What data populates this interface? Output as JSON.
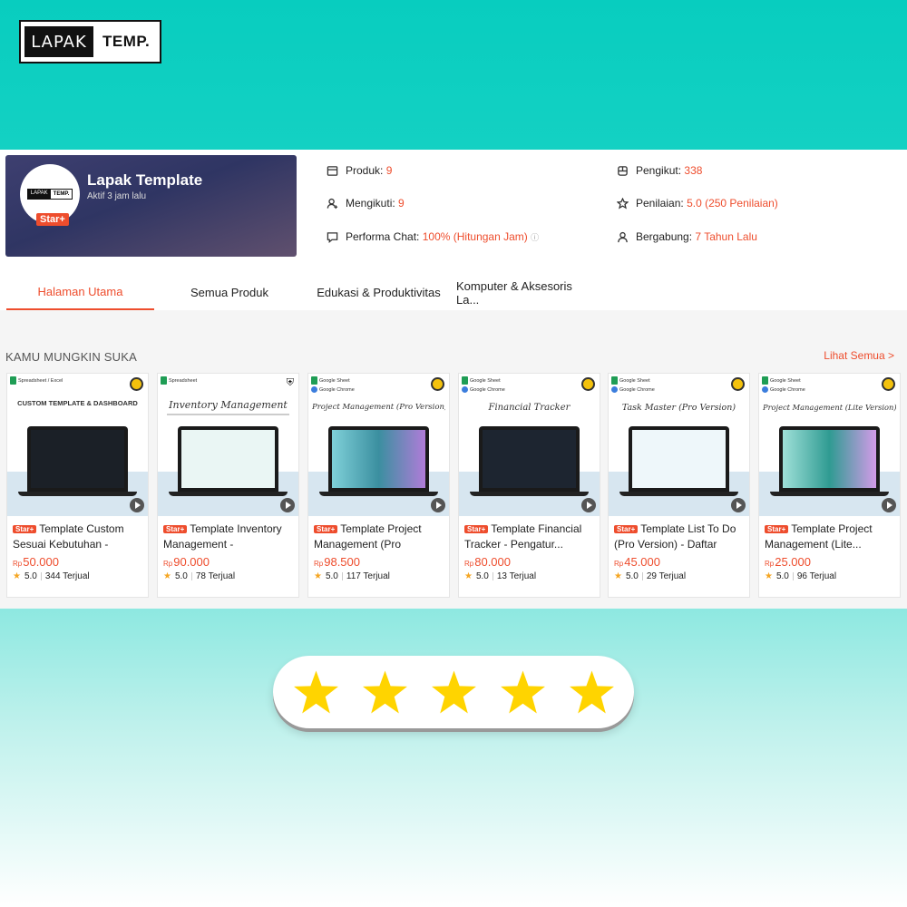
{
  "logo": {
    "left": "LAPAK",
    "right": "TEMP.",
    "mini_left": "LAPAK",
    "mini_right": "TEMP."
  },
  "shop": {
    "name": "Lapak Template",
    "active": "Aktif 3 jam lalu",
    "badge": "Star+",
    "stats": {
      "produk_label": "Produk:",
      "produk_value": "9",
      "mengikuti_label": "Mengikuti:",
      "mengikuti_value": "9",
      "chat_label": "Performa Chat:",
      "chat_value": "100% (Hitungan Jam)",
      "pengikut_label": "Pengikut:",
      "pengikut_value": "338",
      "penilaian_label": "Penilaian:",
      "penilaian_value": "5.0 (250 Penilaian)",
      "bergabung_label": "Bergabung:",
      "bergabung_value": "7 Tahun Lalu"
    }
  },
  "tabs": [
    "Halaman Utama",
    "Semua Produk",
    "Edukasi & Produktivitas",
    "Komputer & Aksesoris La..."
  ],
  "section": {
    "title": "KAMU MUNGKIN SUKA",
    "see_all": "Lihat Semua >"
  },
  "products": [
    {
      "tag": "Spreadsheet / Excel",
      "tag2": "",
      "art": "CUSTOM TEMPLATE & DASHBOARD",
      "name": "Template Custom Sesuai Kebutuhan - Projec...",
      "currency": "Rp",
      "price": "50.000",
      "rating": "5.0",
      "sold": "344 Terjual"
    },
    {
      "tag": "Spreadsheet",
      "tag2": "",
      "art": "Inventory Management",
      "name": "Template Inventory Management - Manajeme...",
      "currency": "Rp",
      "price": "90.000",
      "rating": "5.0",
      "sold": "78 Terjual"
    },
    {
      "tag": "Google Sheet",
      "tag2": "Google Chrome",
      "art": "Project Management (Pro Version)",
      "name": "Template Project Management (Pro Version...",
      "currency": "Rp",
      "price": "98.500",
      "rating": "5.0",
      "sold": "117 Terjual"
    },
    {
      "tag": "Google Sheet",
      "tag2": "Google Chrome",
      "art": "Financial Tracker",
      "name": "Template Financial Tracker - Pengatur...",
      "currency": "Rp",
      "price": "80.000",
      "rating": "5.0",
      "sold": "13 Terjual"
    },
    {
      "tag": "Google Sheet",
      "tag2": "Google Chrome",
      "art": "Task Master (Pro Version)",
      "name": "Template List To Do (Pro Version) - Daftar Tug...",
      "currency": "Rp",
      "price": "45.000",
      "rating": "5.0",
      "sold": "29 Terjual"
    },
    {
      "tag": "Google Sheet",
      "tag2": "Google Chrome",
      "art": "Project Management (Lite Version)",
      "name": "Template Project Management (Lite...",
      "currency": "Rp",
      "price": "25.000",
      "rating": "5.0",
      "sold": "96 Terjual"
    }
  ],
  "badge_label": "Star+",
  "rating_display": {
    "stars": 5,
    "max": 5,
    "color": "#ffd400"
  },
  "colors": {
    "accent": "#ee4d2d",
    "teal": "#08cdbf"
  }
}
